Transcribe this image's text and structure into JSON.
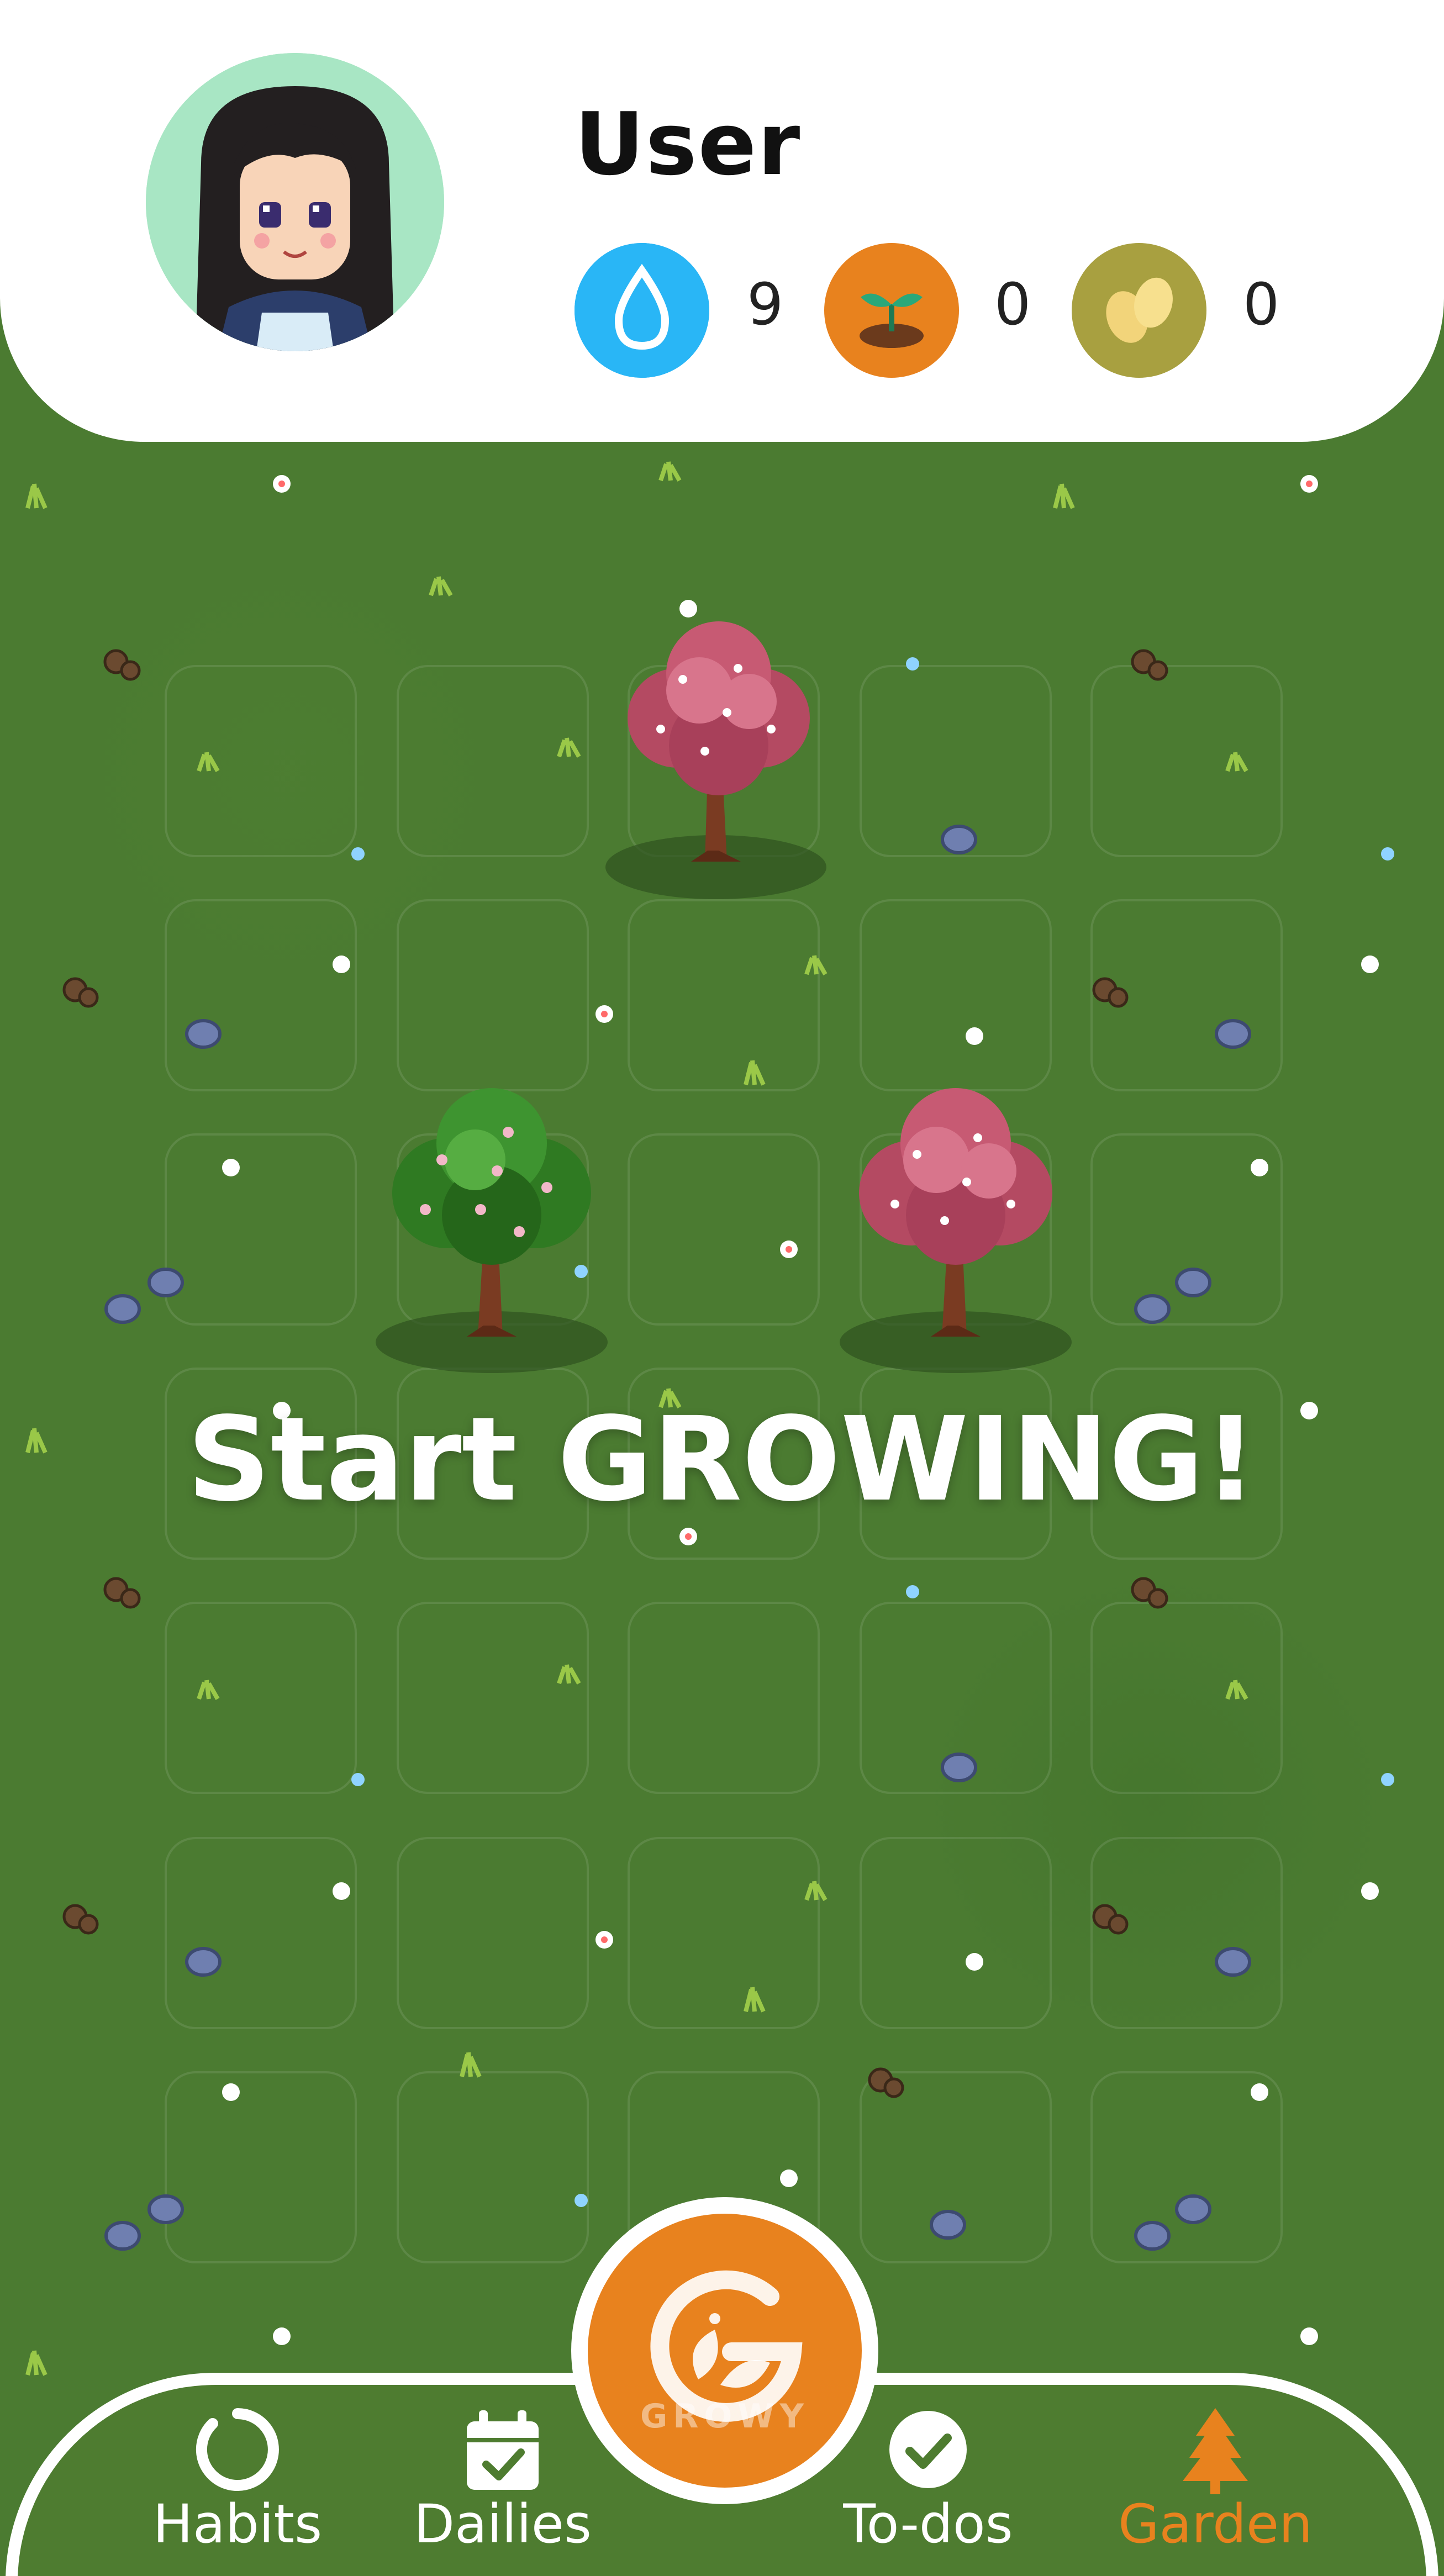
{
  "header": {
    "username": "User",
    "stats": [
      {
        "name": "water",
        "icon": "water-drop-icon",
        "value": "9",
        "color": "#29b6f6"
      },
      {
        "name": "seedlings",
        "icon": "seedling-icon",
        "value": "0",
        "color": "#e8821e"
      },
      {
        "name": "seeds",
        "icon": "seeds-icon",
        "value": "0",
        "color": "#a8a040"
      }
    ]
  },
  "garden": {
    "title": "Start GROWING!",
    "plots_columns": 5,
    "plots_rows": 7,
    "trees": [
      {
        "type": "cherry-blossom-tree",
        "plot": "row1-col3"
      },
      {
        "type": "green-flowering-tree",
        "plot": "row3-col2"
      },
      {
        "type": "cherry-blossom-tree",
        "plot": "row3-col4"
      }
    ]
  },
  "fab": {
    "logo_text": "GROWY",
    "color": "#e8821e"
  },
  "nav": {
    "items": [
      {
        "label": "Habits",
        "icon": "habits-ring-icon",
        "active": false
      },
      {
        "label": "Dailies",
        "icon": "calendar-check-icon",
        "active": false
      },
      {
        "label": "To-dos",
        "icon": "check-circle-icon",
        "active": false
      },
      {
        "label": "Garden",
        "icon": "pine-tree-icon",
        "active": true
      }
    ],
    "active_color": "#e8821e"
  }
}
